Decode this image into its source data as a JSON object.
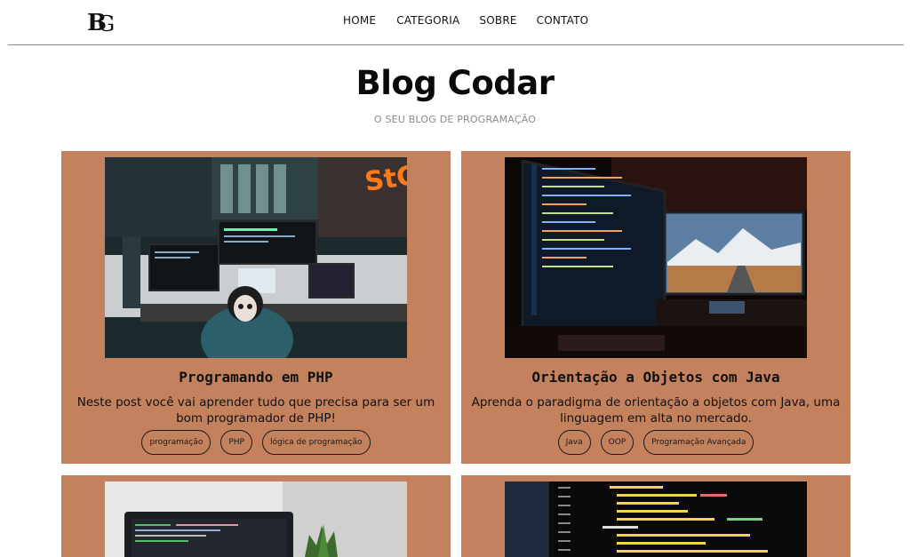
{
  "header": {
    "logo_alt": "BG",
    "nav": [
      "HOME",
      "CATEGORIA",
      "SOBRE",
      "CONTATO"
    ]
  },
  "hero": {
    "title": "Blog Codar",
    "subtitle": "O SEU BLOG DE PROGRAMAÇÃO"
  },
  "posts": [
    {
      "title": "Programando em PHP",
      "description": "Neste post você vai aprender tudo que precisa para ser um bom programador de PHP!",
      "tags": [
        "programação",
        "PHP",
        "lógica de programação"
      ]
    },
    {
      "title": "Orientação a Objetos com Java",
      "description": "Aprenda o paradigma de orientação a objetos com Java, uma linguagem em alta no mercado.",
      "tags": [
        "Java",
        "OOP",
        "Programação Avançada"
      ]
    }
  ],
  "colors": {
    "card_bg": "#c3815d",
    "divider": "#8a8a8a",
    "subtitle": "#8a8a8a"
  }
}
